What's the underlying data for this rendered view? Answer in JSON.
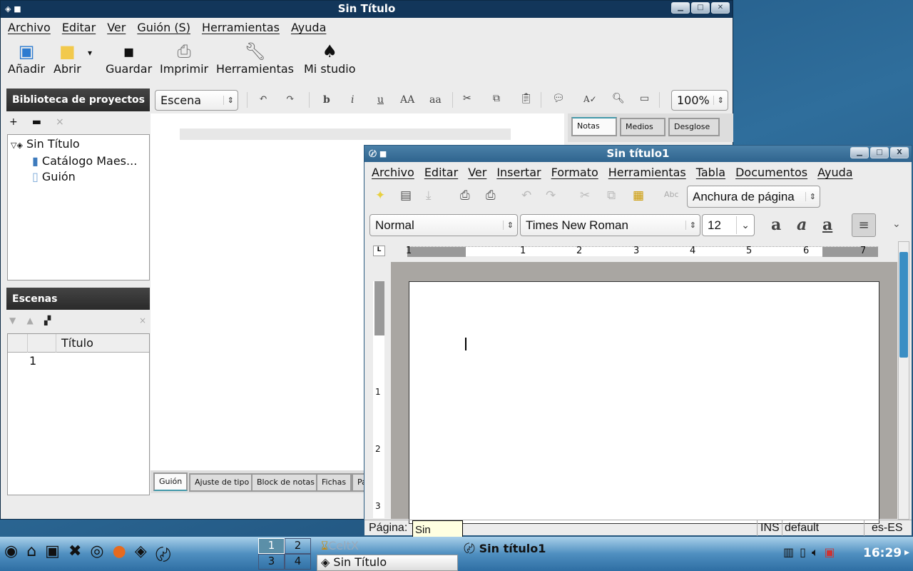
{
  "celtx": {
    "title": "Sin Título",
    "menu": [
      "Archivo",
      "Editar",
      "Ver",
      "Guión (S)",
      "Herramientas",
      "Ayuda"
    ],
    "toolbar": [
      {
        "label": "Añadir",
        "icon": "add-book-icon"
      },
      {
        "label": "Abrir",
        "icon": "folder-icon"
      },
      {
        "label": "Guardar",
        "icon": "floppy-icon"
      },
      {
        "label": "Imprimir",
        "icon": "printer-icon"
      },
      {
        "label": "Herramientas",
        "icon": "wrench-icon"
      },
      {
        "label": "Mi studio",
        "icon": "spade-icon"
      }
    ],
    "library": {
      "header": "Biblioteca de proyectos",
      "tree": {
        "root": "Sin Título",
        "children": [
          "Catálogo Maes...",
          "Guión"
        ]
      }
    },
    "scenes": {
      "header": "Escenas",
      "column": "Título",
      "rows": [
        "1"
      ]
    },
    "format_select": "Escena",
    "format_buttons": [
      "b",
      "i",
      "u",
      "AA",
      "aa"
    ],
    "zoom": "100%",
    "side_tabs": [
      "Notas",
      "Medios",
      "Desglose"
    ],
    "bottom_tabs": [
      "Guión",
      "Ajuste de tipo",
      "Block de notas",
      "Fichas",
      "Pá"
    ]
  },
  "writer": {
    "title": "Sin título1",
    "menu": [
      "Archivo",
      "Editar",
      "Ver",
      "Insertar",
      "Formato",
      "Herramientas",
      "Tabla",
      "Documentos",
      "Ayuda"
    ],
    "zoom_select": "Anchura de página",
    "style": "Normal",
    "font": "Times New Roman",
    "size": "12",
    "ruler_h": [
      "1",
      "1",
      "2",
      "3",
      "4",
      "5",
      "6",
      "7"
    ],
    "ruler_v": [
      "1",
      "2",
      "3"
    ],
    "status": {
      "page_label": "Página:",
      "mode": "INS",
      "lang_style": "default",
      "lang": "es-ES"
    }
  },
  "tooltip": "Sin Título",
  "taskbar": {
    "pager": [
      "1",
      "2",
      "3",
      "4"
    ],
    "tasks": [
      "CeltX",
      "Sin Título",
      "Sin título1"
    ],
    "clock": "16:29"
  }
}
